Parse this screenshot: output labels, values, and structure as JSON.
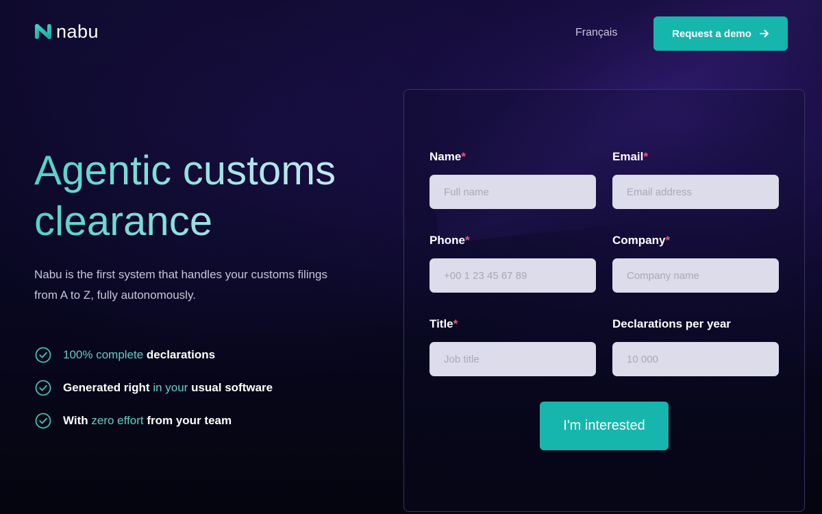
{
  "brand": {
    "name": "nabu",
    "accent": "#16b6ad",
    "teal_text": "#5fd0c4"
  },
  "header": {
    "language_link": "Français",
    "demo_button": "Request a demo",
    "demo_icon": "arrow-right-icon"
  },
  "hero": {
    "title": "Agentic customs clearance",
    "subtitle": "Nabu is the first system that handles your customs filings from A to Z, fully autonomously.",
    "features": [
      {
        "icon": "check-circle-icon",
        "parts": [
          {
            "text": "100% complete",
            "accent": true
          },
          {
            "text": " declarations",
            "accent": false
          }
        ]
      },
      {
        "icon": "check-circle-icon",
        "parts": [
          {
            "text": "Generated right ",
            "accent": false
          },
          {
            "text": "in your",
            "accent": true
          },
          {
            "text": " usual software",
            "accent": false
          }
        ]
      },
      {
        "icon": "check-circle-icon",
        "parts": [
          {
            "text": "With ",
            "accent": false
          },
          {
            "text": "zero effort",
            "accent": true
          },
          {
            "text": " from your team",
            "accent": false
          }
        ]
      }
    ]
  },
  "form": {
    "fields": {
      "name": {
        "label": "Name",
        "required": "*",
        "placeholder": "Full name"
      },
      "email": {
        "label": "Email",
        "required": "*",
        "placeholder": "Email address"
      },
      "phone": {
        "label": "Phone",
        "required": "*",
        "placeholder": "+00 1 23 45 67 89"
      },
      "company": {
        "label": "Company",
        "required": "*",
        "placeholder": "Company name"
      },
      "title": {
        "label": "Title",
        "required": "*",
        "placeholder": "Job title"
      },
      "declarations": {
        "label": "Declarations per year",
        "required": "",
        "placeholder": "10 000"
      }
    },
    "submit": "I'm interested"
  }
}
